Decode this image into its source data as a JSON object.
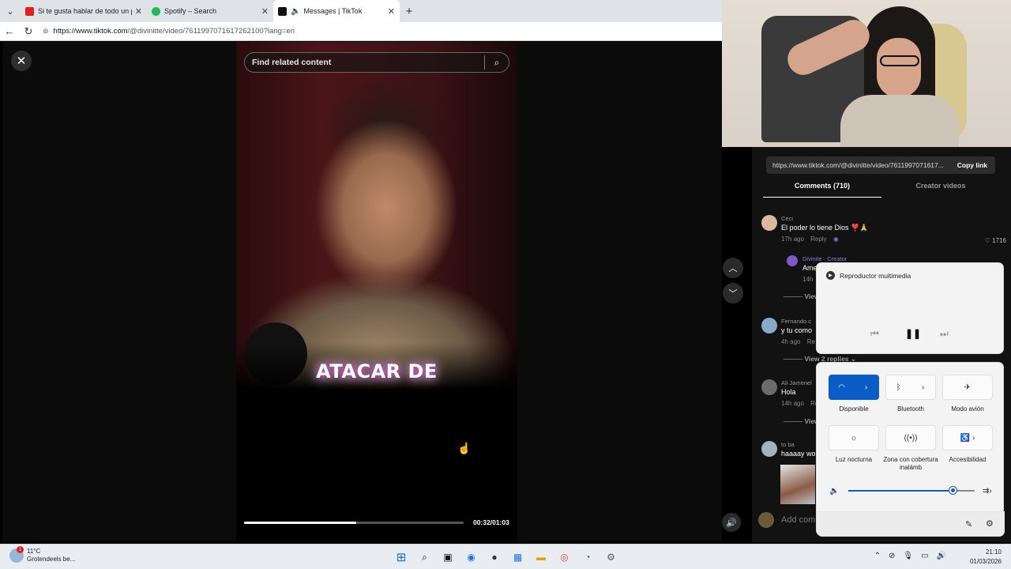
{
  "browser": {
    "tabs": [
      {
        "title": "Si te gusta hablar de todo un poco",
        "favicon_color": "#e02020"
      },
      {
        "title": "Spotify – Search",
        "favicon_color": "#1db954"
      },
      {
        "title": "Messages | TikTok",
        "favicon_color": "#111111"
      }
    ],
    "url_host": "https://www.tiktok.com",
    "url_path": "/@divinitte/video/7611997071617262100?lang=en"
  },
  "video": {
    "search_placeholder": "Find related content",
    "caption": "ATACAR DE",
    "time": "00:32/01:03",
    "progress": 0.51
  },
  "comments_panel": {
    "share_link": "https://www.tiktok.com/@divinitte/video/7611997071617...",
    "copy_label": "Copy link",
    "tab_comments": "Comments (710)",
    "tab_creator": "Creator videos",
    "comments": [
      {
        "user": "Ceci",
        "text": "El poder lo tiene Dios ❣️🙏",
        "time": "17h ago",
        "reply": "Reply",
        "likes": "1716"
      },
      {
        "user": "Divinite · Creator",
        "text": "Ame",
        "time": "14h"
      },
      {
        "user": "Fernando c",
        "text": "y tu como",
        "time": "4h ago",
        "reply": "Re"
      },
      {
        "user": "Ali Jamenel",
        "text": "Hola",
        "time": "14h ago",
        "reply": "Re"
      },
      {
        "user": "to ba",
        "text": "haaaay wo"
      }
    ],
    "view_more": "View",
    "view_replies": "View 2 replies",
    "add_comment_placeholder": "Add comm"
  },
  "media_flyout": {
    "title": "Reproductor multimedia"
  },
  "quick_settings": {
    "tiles": [
      {
        "label": "Disponible",
        "icon": "wifi-icon",
        "on": true
      },
      {
        "label": "Bluetooth",
        "icon": "bluetooth-icon",
        "on": false
      },
      {
        "label": "Modo avión",
        "icon": "airplane-icon",
        "on": false
      },
      {
        "label": "Luz nocturna",
        "icon": "night-light-icon",
        "on": false
      },
      {
        "label": "Zona con cobertura inalámb",
        "icon": "hotspot-icon",
        "on": false
      },
      {
        "label": "Accesibilidad",
        "icon": "accessibility-icon",
        "on": false
      }
    ],
    "volume": 0.83,
    "accent": "#0b5cc7"
  },
  "taskbar": {
    "weather_temp": "11°C",
    "weather_desc": "Grotendeels be...",
    "notification_count": "1",
    "time": "21:10",
    "date": "01/03/2026"
  }
}
